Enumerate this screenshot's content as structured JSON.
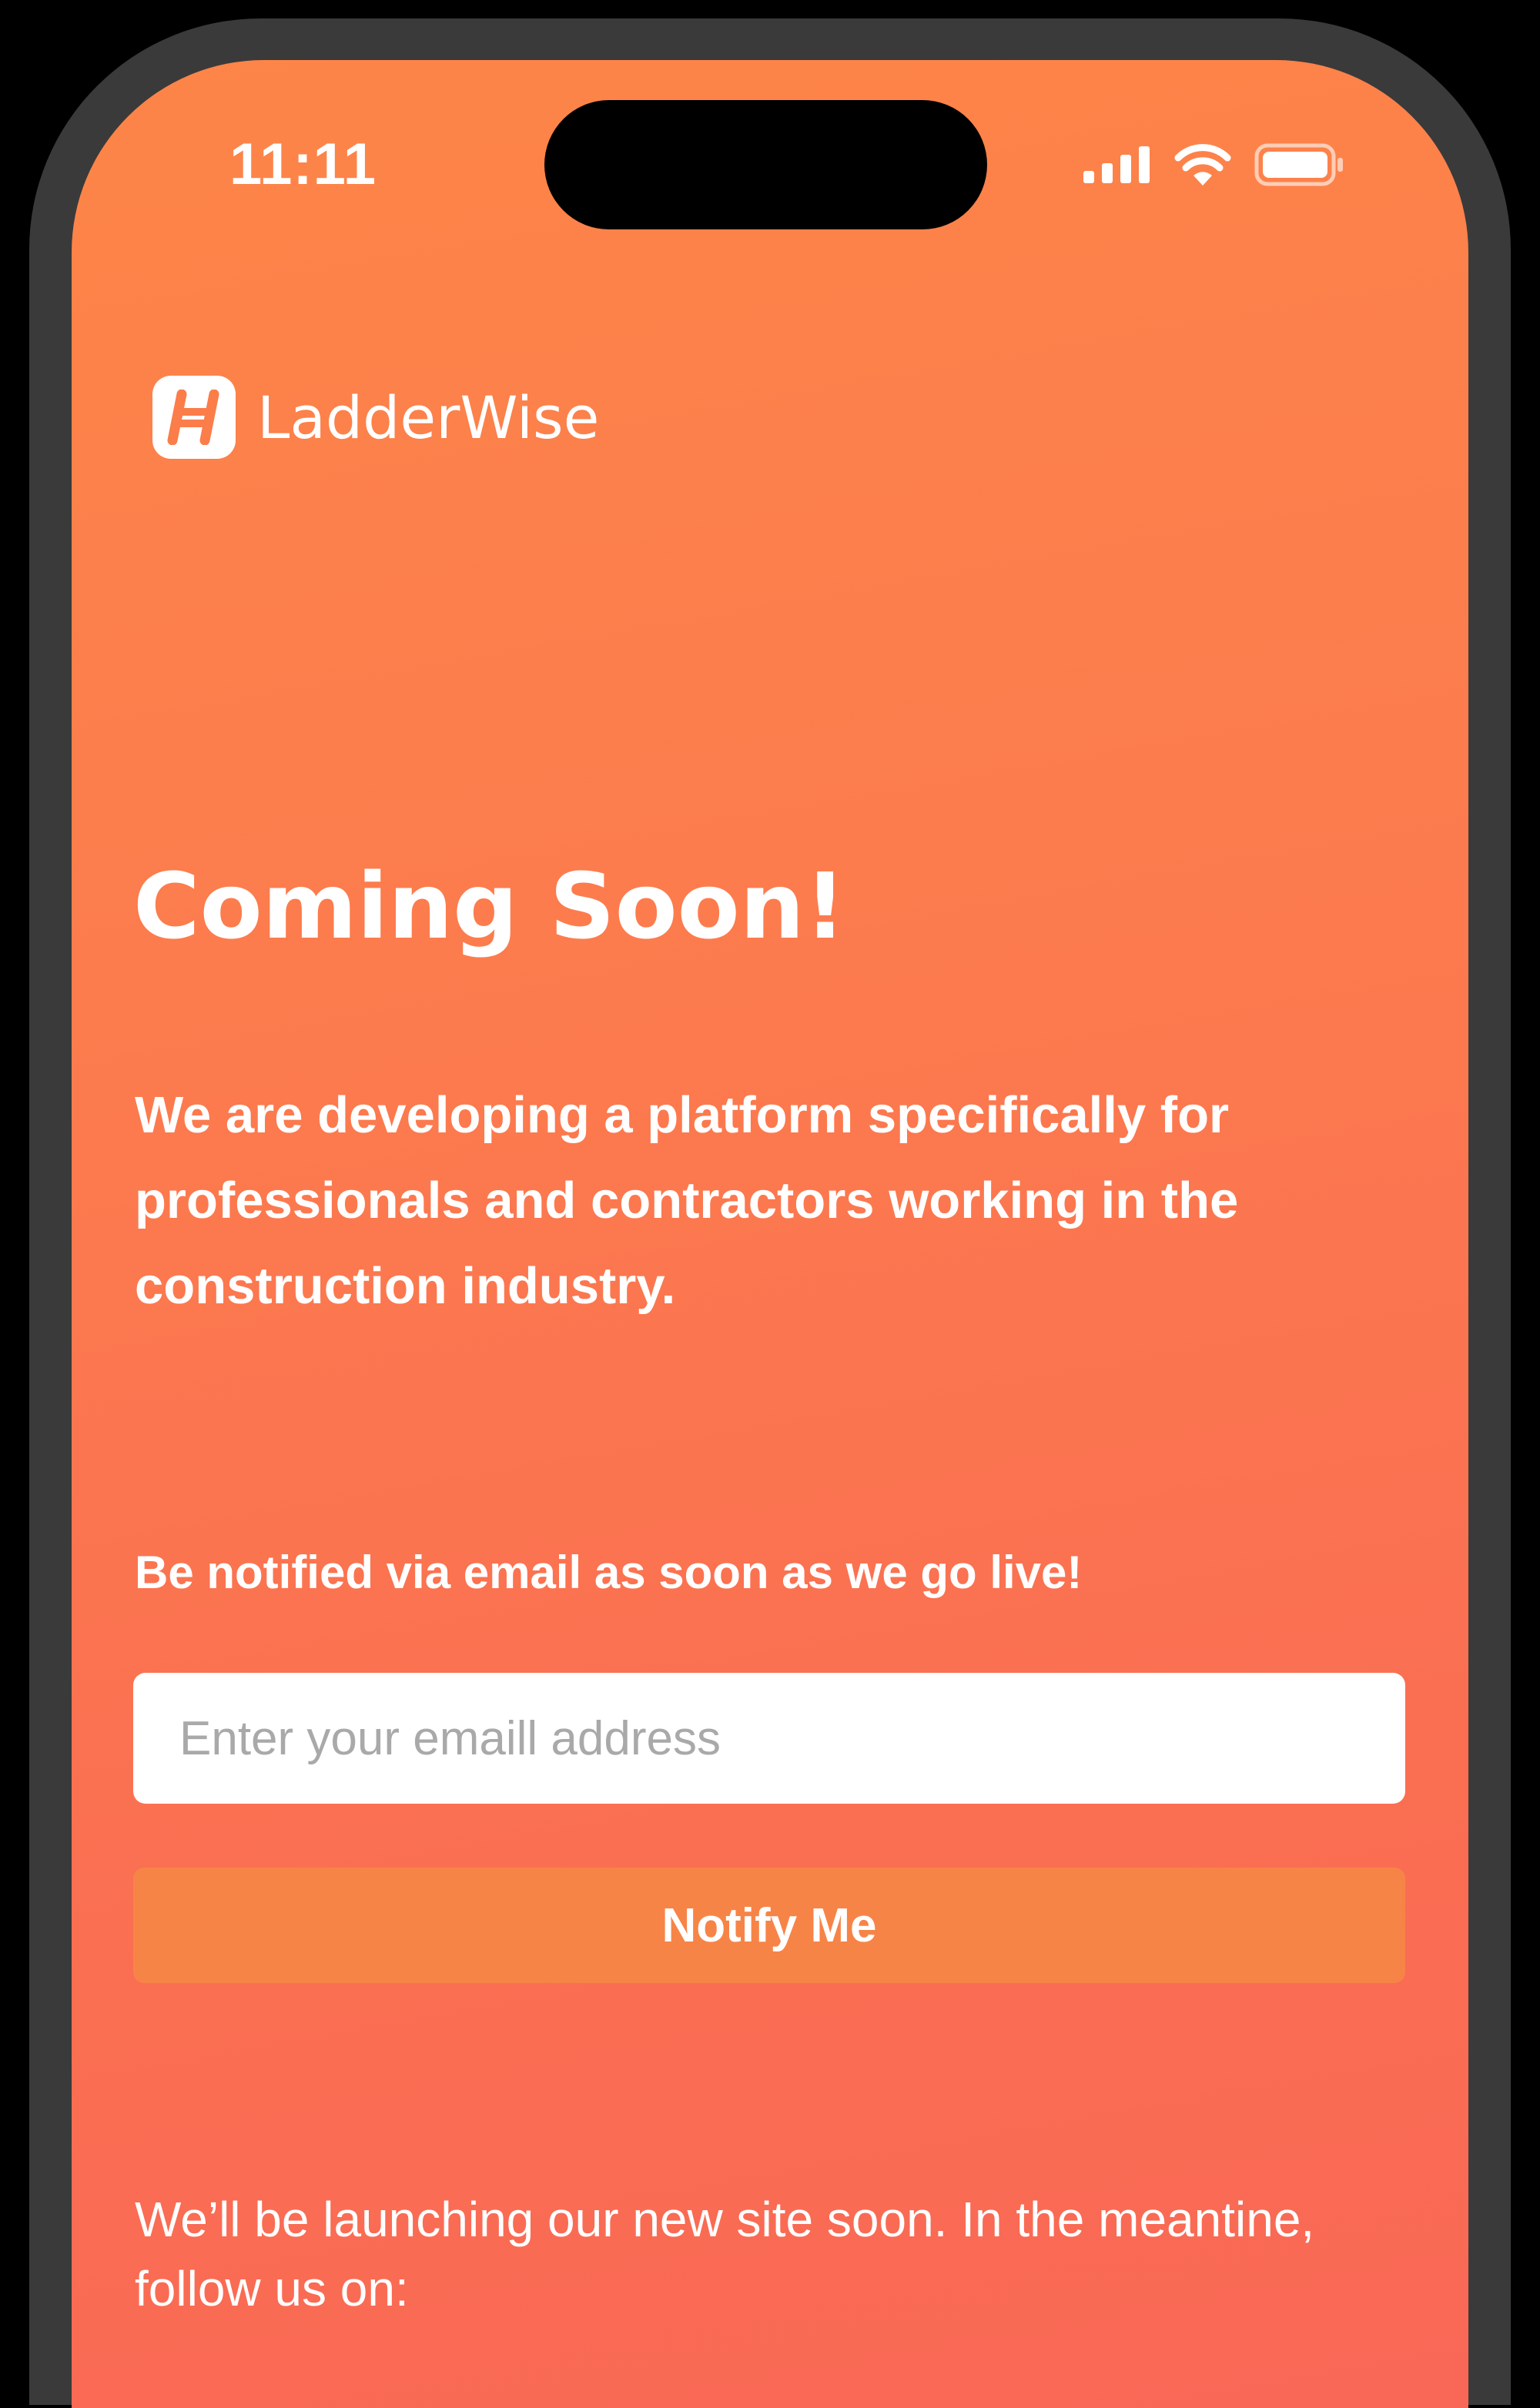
{
  "status_bar": {
    "time": "11:11",
    "icons": [
      "signal-icon",
      "wifi-icon",
      "battery-icon"
    ]
  },
  "brand": {
    "name": "LadderWise",
    "logo_icon": "ladder-logo-icon"
  },
  "hero": {
    "headline": "Coming Soon!",
    "description": "We are developing a platform specifically for professionals and contractors working in the construction industry."
  },
  "notify": {
    "label": "Be notified via email as soon as we go live!",
    "email_placeholder": "Enter your emaill address",
    "email_value": "",
    "button_label": "Notify Me"
  },
  "footer": {
    "text": "We’ll be launching our new site soon. In the meantine, follow us on:"
  },
  "colors": {
    "gradient_top": "#fd8548",
    "gradient_bottom": "#f96856",
    "button_bg": "#f78447",
    "frame": "#3a3a3a"
  }
}
